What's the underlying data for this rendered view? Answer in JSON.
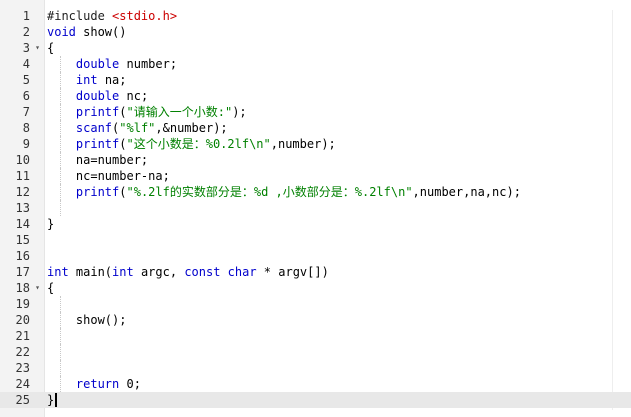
{
  "editor": {
    "lines": [
      {
        "n": "1",
        "fold": false,
        "guide": false,
        "tokens": [
          {
            "t": "#include ",
            "c": "pre"
          },
          {
            "t": "<stdio.h>",
            "c": "inc"
          }
        ]
      },
      {
        "n": "2",
        "fold": false,
        "guide": false,
        "tokens": [
          {
            "t": "void",
            "c": "kw"
          },
          {
            "t": " show()",
            "c": "plain"
          }
        ]
      },
      {
        "n": "3",
        "fold": true,
        "guide": false,
        "tokens": [
          {
            "t": "{",
            "c": "plain"
          }
        ]
      },
      {
        "n": "4",
        "fold": false,
        "guide": true,
        "tokens": [
          {
            "t": "    ",
            "c": "plain"
          },
          {
            "t": "double",
            "c": "kw"
          },
          {
            "t": " number;",
            "c": "plain"
          }
        ]
      },
      {
        "n": "5",
        "fold": false,
        "guide": true,
        "tokens": [
          {
            "t": "    ",
            "c": "plain"
          },
          {
            "t": "int",
            "c": "kw"
          },
          {
            "t": " na;",
            "c": "plain"
          }
        ]
      },
      {
        "n": "6",
        "fold": false,
        "guide": true,
        "tokens": [
          {
            "t": "    ",
            "c": "plain"
          },
          {
            "t": "double",
            "c": "kw"
          },
          {
            "t": " nc;",
            "c": "plain"
          }
        ]
      },
      {
        "n": "7",
        "fold": false,
        "guide": true,
        "tokens": [
          {
            "t": "    ",
            "c": "plain"
          },
          {
            "t": "printf",
            "c": "kw"
          },
          {
            "t": "(",
            "c": "plain"
          },
          {
            "t": "\"请输入一个小数:\"",
            "c": "str"
          },
          {
            "t": ");",
            "c": "plain"
          }
        ]
      },
      {
        "n": "8",
        "fold": false,
        "guide": true,
        "tokens": [
          {
            "t": "    ",
            "c": "plain"
          },
          {
            "t": "scanf",
            "c": "kw"
          },
          {
            "t": "(",
            "c": "plain"
          },
          {
            "t": "\"%lf\"",
            "c": "str"
          },
          {
            "t": ",&number);",
            "c": "plain"
          }
        ]
      },
      {
        "n": "9",
        "fold": false,
        "guide": true,
        "tokens": [
          {
            "t": "    ",
            "c": "plain"
          },
          {
            "t": "printf",
            "c": "kw"
          },
          {
            "t": "(",
            "c": "plain"
          },
          {
            "t": "\"这个小数是：%0.2lf\\n\"",
            "c": "str"
          },
          {
            "t": ",number);",
            "c": "plain"
          }
        ]
      },
      {
        "n": "10",
        "fold": false,
        "guide": true,
        "tokens": [
          {
            "t": "    na=number;",
            "c": "plain"
          }
        ]
      },
      {
        "n": "11",
        "fold": false,
        "guide": true,
        "tokens": [
          {
            "t": "    nc=number-na;",
            "c": "plain"
          }
        ]
      },
      {
        "n": "12",
        "fold": false,
        "guide": true,
        "tokens": [
          {
            "t": "    ",
            "c": "plain"
          },
          {
            "t": "printf",
            "c": "kw"
          },
          {
            "t": "(",
            "c": "plain"
          },
          {
            "t": "\"%.2lf的实数部分是：%d ,小数部分是：%.2lf\\n\"",
            "c": "str"
          },
          {
            "t": ",number,na,nc);",
            "c": "plain"
          }
        ]
      },
      {
        "n": "13",
        "fold": false,
        "guide": true,
        "tokens": []
      },
      {
        "n": "14",
        "fold": false,
        "guide": false,
        "tokens": [
          {
            "t": "}",
            "c": "plain"
          }
        ]
      },
      {
        "n": "15",
        "fold": false,
        "guide": false,
        "tokens": []
      },
      {
        "n": "16",
        "fold": false,
        "guide": false,
        "tokens": []
      },
      {
        "n": "17",
        "fold": false,
        "guide": false,
        "tokens": [
          {
            "t": "int",
            "c": "kw"
          },
          {
            "t": " main(",
            "c": "plain"
          },
          {
            "t": "int",
            "c": "kw"
          },
          {
            "t": " argc, ",
            "c": "plain"
          },
          {
            "t": "const",
            "c": "kw"
          },
          {
            "t": " ",
            "c": "plain"
          },
          {
            "t": "char",
            "c": "kw"
          },
          {
            "t": " * argv[])",
            "c": "plain"
          }
        ]
      },
      {
        "n": "18",
        "fold": true,
        "guide": false,
        "tokens": [
          {
            "t": "{",
            "c": "plain"
          }
        ]
      },
      {
        "n": "19",
        "fold": false,
        "guide": true,
        "tokens": []
      },
      {
        "n": "20",
        "fold": false,
        "guide": true,
        "tokens": [
          {
            "t": "    show();",
            "c": "plain"
          }
        ]
      },
      {
        "n": "21",
        "fold": false,
        "guide": true,
        "tokens": []
      },
      {
        "n": "22",
        "fold": false,
        "guide": true,
        "tokens": []
      },
      {
        "n": "23",
        "fold": false,
        "guide": true,
        "tokens": []
      },
      {
        "n": "24",
        "fold": false,
        "guide": true,
        "tokens": [
          {
            "t": "    ",
            "c": "plain"
          },
          {
            "t": "return",
            "c": "kw"
          },
          {
            "t": " 0;",
            "c": "plain"
          }
        ]
      },
      {
        "n": "25",
        "fold": false,
        "guide": false,
        "active": true,
        "cursor": true,
        "tokens": [
          {
            "t": "}",
            "c": "plain"
          }
        ]
      }
    ]
  },
  "colors": {
    "keyword": "#0000cc",
    "string": "#008000",
    "include_path": "#cc0000",
    "gutter_bg": "#f3f3f3",
    "active_line_bg": "#e8e8e8"
  },
  "icons": {
    "fold_marker": "chevron-down-icon"
  }
}
